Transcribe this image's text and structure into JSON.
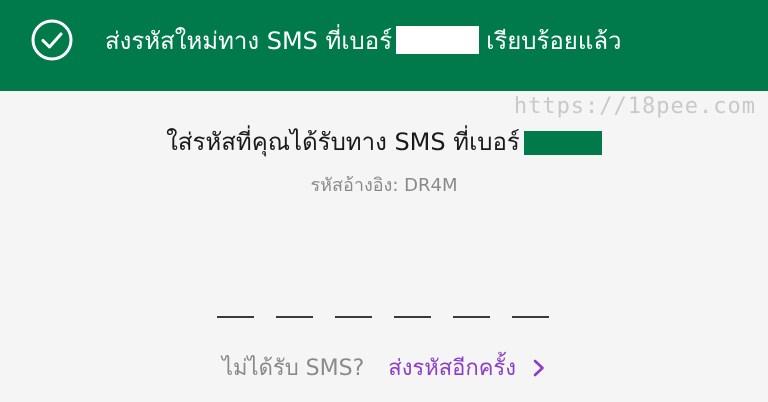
{
  "banner": {
    "message_prefix": "ส่งรหัสใหม่ทาง SMS ที่เบอร์",
    "message_suffix": "เรียบร้อยแล้ว",
    "icon": "check-circle-icon",
    "color": "#007a4a"
  },
  "watermark": {
    "text": "https://18pee.com"
  },
  "instruction": {
    "text": "ใส่รหัสที่คุณได้รับทาง SMS ที่เบอร์"
  },
  "reference": {
    "text": "รหัสอ้างอิง: DR4M"
  },
  "otp": {
    "slot_count": 6
  },
  "resend": {
    "question": "ไม่ได้รับ SMS?",
    "link_label": "ส่งรหัสอีกครั้ง",
    "icon": "chevron-right-icon",
    "color": "#8b3fc5"
  }
}
